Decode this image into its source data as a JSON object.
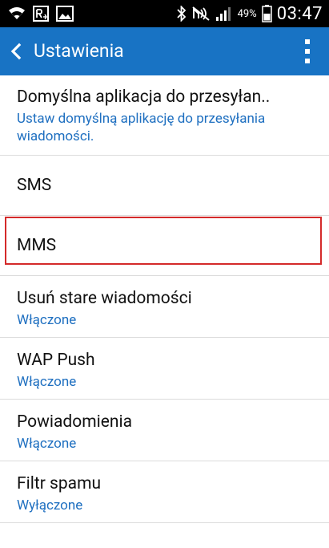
{
  "status_bar": {
    "battery_percent": "49%",
    "time": "03:47",
    "icons": [
      "wifi-icon",
      "roaming-icon",
      "image-notification-icon",
      "bluetooth-icon",
      "mute-icon",
      "signal-icon",
      "battery-icon"
    ]
  },
  "app_bar": {
    "title": "Ustawienia",
    "background": "#1873c4"
  },
  "settings": {
    "default_app": {
      "title": "Domyślna aplikacja do przesyłan..",
      "subtitle": "Ustaw domyślną aplikację do przesyłania wiadomości."
    },
    "sms": {
      "title": "SMS"
    },
    "mms": {
      "title": "MMS"
    },
    "delete_old": {
      "title": "Usuń stare wiadomości",
      "status": "Włączone"
    },
    "wap_push": {
      "title": "WAP Push",
      "status": "Włączone"
    },
    "notifications": {
      "title": "Powiadomienia",
      "status": "Włączone"
    },
    "spam_filter": {
      "title": "Filtr spamu",
      "status": "Wyłączone"
    }
  },
  "colors": {
    "accent": "#1e6fc0",
    "highlight": "#d42a2a"
  }
}
